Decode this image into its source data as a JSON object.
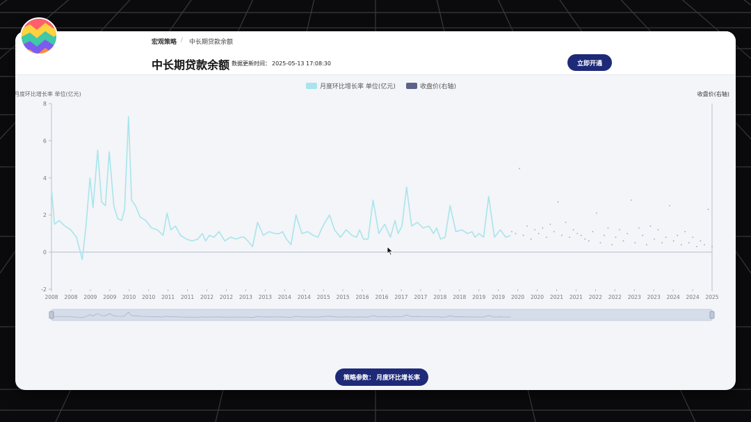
{
  "breadcrumb": {
    "root": "宏观策略",
    "separator": "/",
    "current": "中长期贷款余额"
  },
  "header": {
    "title": "中长期贷款余额",
    "update_label": "数据更新时间：",
    "update_time": "2025-05-13 17:08:30",
    "open_button": "立即开通"
  },
  "footer": {
    "param_label": "策略参数：",
    "param_value": "月度环比增长率"
  },
  "colors": {
    "series1": "#a8e4ec",
    "series2": "#5b6488",
    "button": "#1e2a78",
    "axis": "#b7bfcc"
  },
  "chart_data": {
    "type": "line",
    "title": "",
    "y_left_label": "月度环比增长率 单位(亿元)",
    "y_right_label": "收盘价(右轴)",
    "ylim": [
      -2,
      8
    ],
    "yticks": [
      -2,
      0,
      2,
      4,
      6,
      8
    ],
    "x_tick_labels": [
      "2008",
      "2008",
      "2009",
      "2009",
      "2010",
      "2010",
      "2011",
      "2011",
      "2012",
      "2012",
      "2013",
      "2013",
      "2014",
      "2014",
      "2015",
      "2015",
      "2016",
      "2016",
      "2017",
      "2017",
      "2018",
      "2018",
      "2019",
      "2019",
      "2020",
      "2020",
      "2021",
      "2021",
      "2022",
      "2022",
      "2023",
      "2023",
      "2024",
      "2024",
      "2025"
    ],
    "grid": false,
    "legend_position": "top-center",
    "series": [
      {
        "name": "月度环比增长率 单位(亿元)",
        "style": "line",
        "x": [
          2008.0,
          2008.08,
          2008.2,
          2008.35,
          2008.5,
          2008.65,
          2008.8,
          2008.9,
          2009.0,
          2009.08,
          2009.2,
          2009.3,
          2009.4,
          2009.5,
          2009.62,
          2009.72,
          2009.82,
          2009.9,
          2010.0,
          2010.08,
          2010.18,
          2010.3,
          2010.45,
          2010.6,
          2010.75,
          2010.9,
          2011.0,
          2011.1,
          2011.22,
          2011.35,
          2011.5,
          2011.65,
          2011.8,
          2011.92,
          2012.0,
          2012.1,
          2012.22,
          2012.35,
          2012.5,
          2012.65,
          2012.8,
          2012.92,
          2013.0,
          2013.1,
          2013.22,
          2013.35,
          2013.5,
          2013.65,
          2013.8,
          2013.92,
          2014.0,
          2014.1,
          2014.22,
          2014.35,
          2014.5,
          2014.65,
          2014.8,
          2014.92,
          2015.0,
          2015.1,
          2015.22,
          2015.35,
          2015.5,
          2015.65,
          2015.8,
          2015.92,
          2016.0,
          2016.1,
          2016.22,
          2016.35,
          2016.5,
          2016.65,
          2016.8,
          2016.92,
          2017.0,
          2017.1,
          2017.22,
          2017.35,
          2017.5,
          2017.65,
          2017.8,
          2017.92,
          2018.0,
          2018.1,
          2018.22,
          2018.35,
          2018.5,
          2018.65,
          2018.8,
          2018.92,
          2019.0,
          2019.1,
          2019.22,
          2019.35,
          2019.5,
          2019.65,
          2019.8,
          2019.92
        ],
        "values": [
          3.4,
          1.5,
          1.7,
          1.4,
          1.2,
          0.8,
          -0.4,
          1.5,
          4.0,
          2.4,
          5.5,
          2.7,
          2.5,
          5.4,
          2.5,
          1.8,
          1.7,
          2.3,
          7.3,
          2.8,
          2.5,
          1.9,
          1.7,
          1.3,
          1.2,
          0.9,
          2.1,
          1.2,
          1.4,
          0.9,
          0.7,
          0.6,
          0.7,
          1.0,
          0.6,
          0.9,
          0.8,
          1.1,
          0.6,
          0.8,
          0.7,
          0.8,
          0.8,
          0.6,
          0.3,
          1.6,
          0.9,
          1.1,
          1.0,
          1.0,
          1.1,
          0.7,
          0.4,
          2.0,
          1.0,
          1.1,
          0.9,
          0.8,
          1.2,
          1.6,
          2.0,
          1.2,
          0.8,
          1.2,
          0.9,
          0.8,
          1.2,
          0.7,
          0.7,
          2.8,
          1.0,
          1.5,
          0.8,
          1.7,
          1.0,
          1.4,
          3.5,
          1.4,
          1.6,
          1.3,
          1.4,
          1.0,
          1.3,
          0.7,
          0.8,
          2.5,
          1.1,
          1.2,
          1.0,
          1.1,
          0.8,
          1.0,
          0.8,
          3.0,
          0.8,
          1.2,
          0.8,
          0.9
        ]
      },
      {
        "name": "收盘价(右轴)",
        "style": "dots",
        "x": [
          2019.95,
          2020.05,
          2020.15,
          2020.25,
          2020.35,
          2020.45,
          2020.55,
          2020.65,
          2020.75,
          2020.85,
          2020.95,
          2021.05,
          2021.15,
          2021.25,
          2021.35,
          2021.45,
          2021.55,
          2021.65,
          2021.75,
          2021.85,
          2021.95,
          2022.05,
          2022.15,
          2022.25,
          2022.35,
          2022.45,
          2022.55,
          2022.65,
          2022.75,
          2022.85,
          2022.95,
          2023.05,
          2023.15,
          2023.25,
          2023.35,
          2023.45,
          2023.55,
          2023.65,
          2023.75,
          2023.85,
          2023.95,
          2024.05,
          2024.15,
          2024.25,
          2024.35,
          2024.45,
          2024.55,
          2024.65,
          2024.75,
          2024.85,
          2024.95,
          2025.05,
          2025.15
        ],
        "values": [
          1.1,
          1.0,
          4.5,
          0.9,
          1.4,
          0.7,
          1.2,
          1.0,
          1.3,
          0.8,
          1.5,
          1.1,
          2.7,
          0.9,
          1.6,
          0.8,
          1.2,
          1.0,
          0.9,
          0.7,
          0.6,
          1.1,
          2.1,
          0.5,
          0.9,
          1.3,
          0.4,
          0.8,
          1.2,
          0.6,
          1.0,
          2.8,
          0.5,
          1.3,
          0.9,
          0.4,
          1.4,
          0.7,
          1.2,
          0.5,
          0.8,
          2.5,
          0.6,
          0.9,
          0.4,
          1.1,
          0.5,
          0.8,
          0.3,
          0.6,
          0.4,
          2.3,
          0.3
        ]
      }
    ]
  }
}
